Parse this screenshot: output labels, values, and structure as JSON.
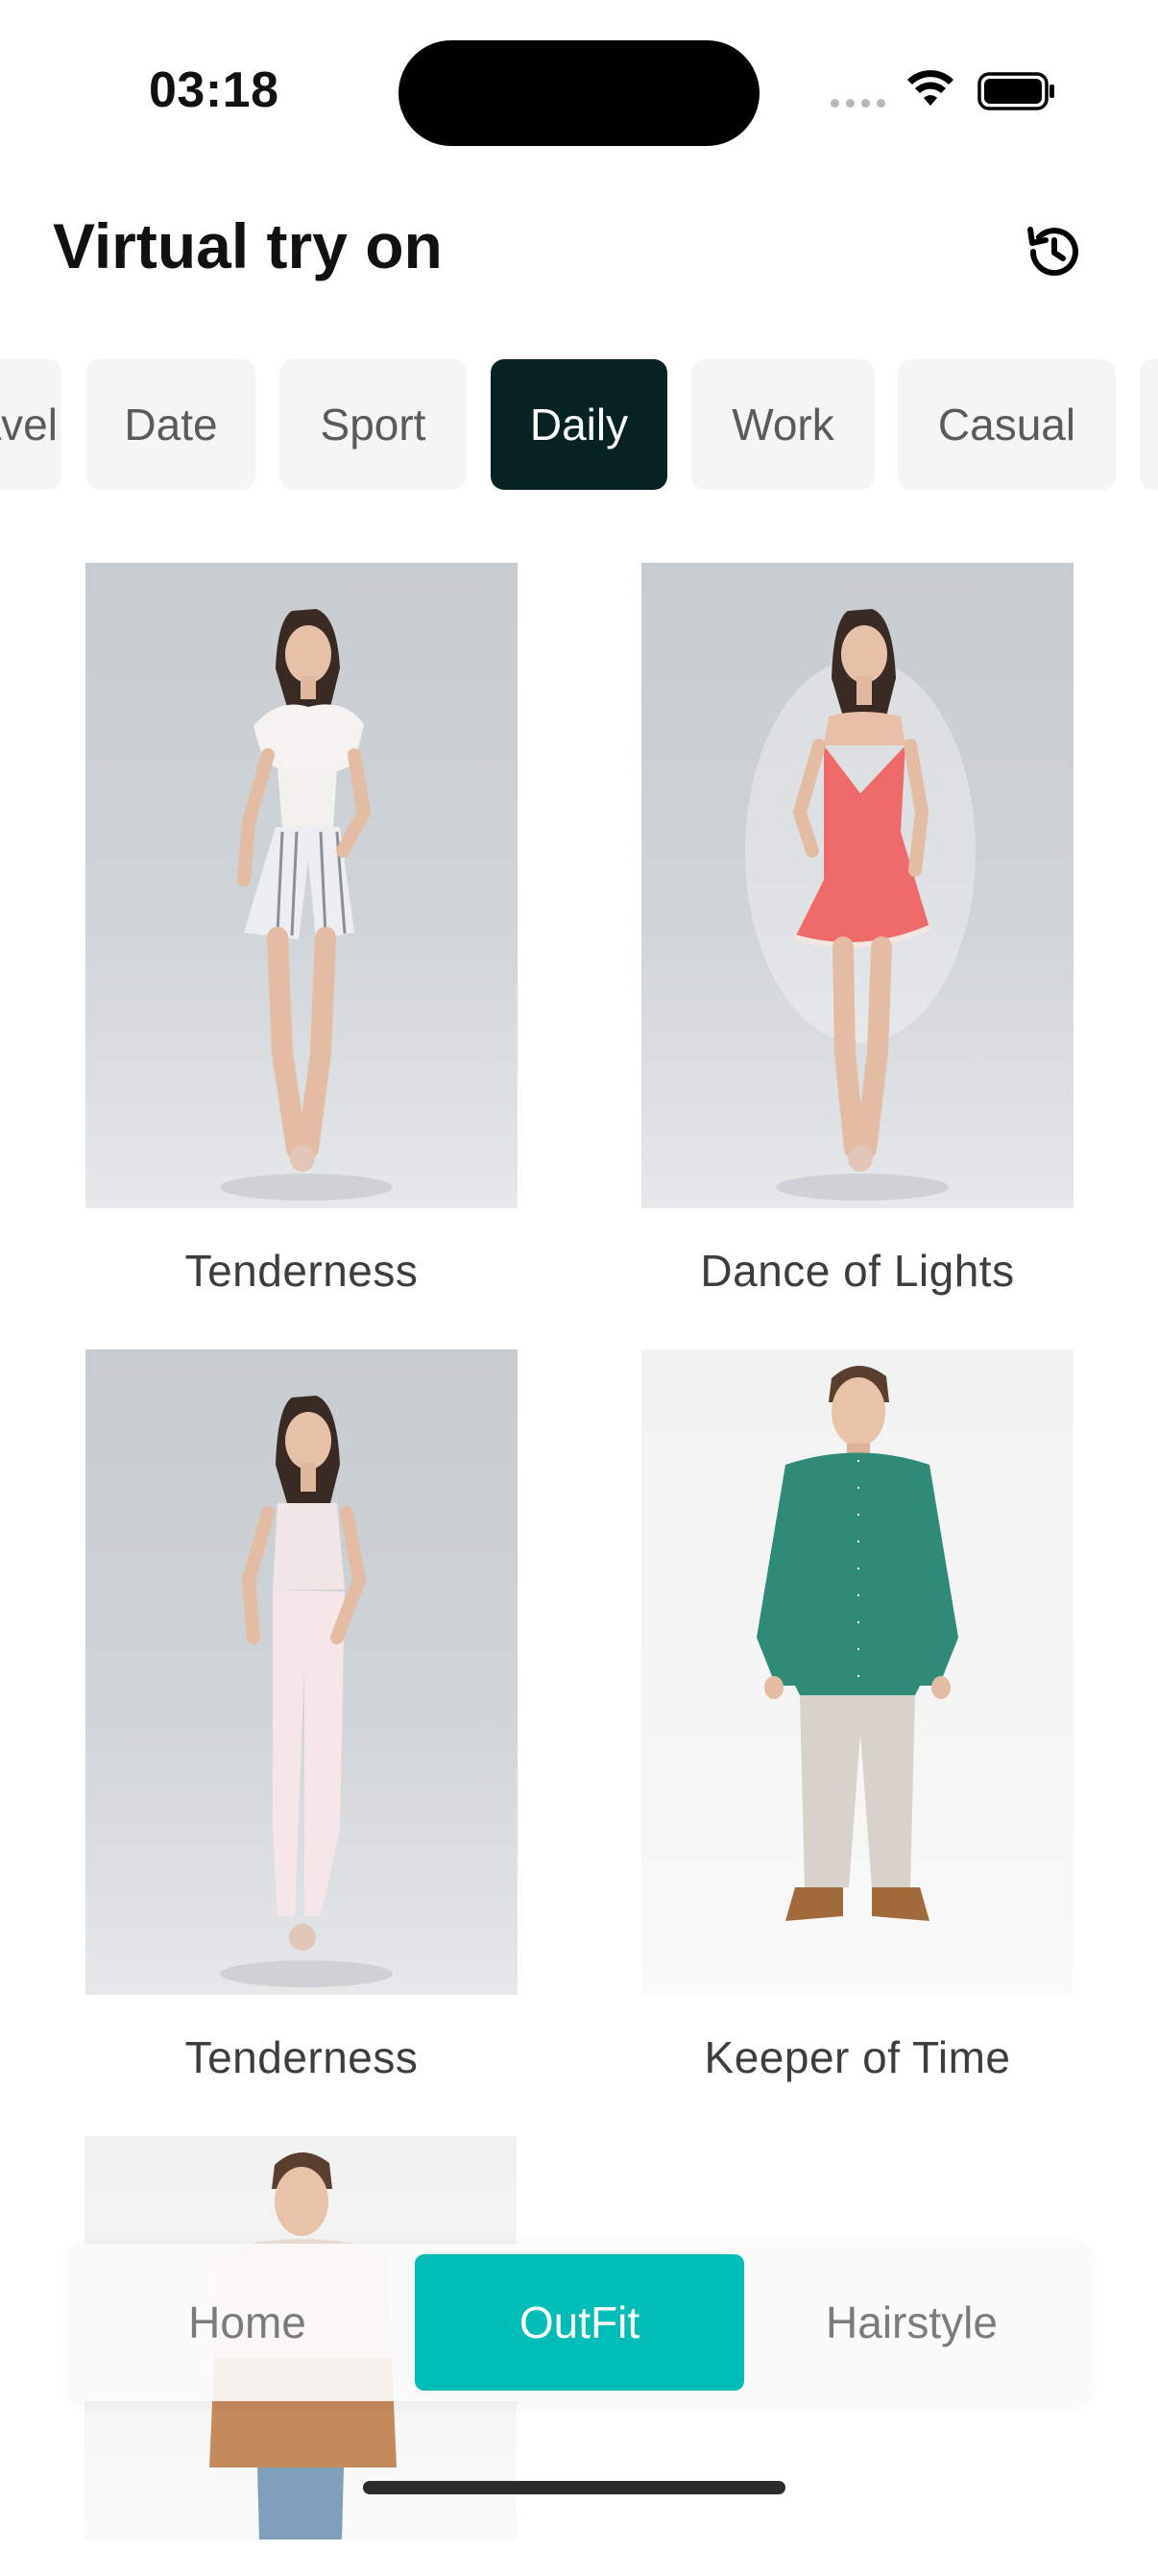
{
  "status": {
    "time": "03:18"
  },
  "header": {
    "title": "Virtual try on"
  },
  "icons": {
    "history": "history-icon",
    "wifi": "wifi-icon",
    "battery": "battery-icon",
    "signal": "signal-icon"
  },
  "tabs": [
    {
      "label": "Travel",
      "active": false
    },
    {
      "label": "Date",
      "active": false
    },
    {
      "label": "Sport",
      "active": false
    },
    {
      "label": "Daily",
      "active": true
    },
    {
      "label": "Work",
      "active": false
    },
    {
      "label": "Casual",
      "active": false
    },
    {
      "label": "",
      "active": false
    }
  ],
  "outfits": [
    {
      "name": "Tenderness"
    },
    {
      "name": "Dance of Lights"
    },
    {
      "name": "Tenderness"
    },
    {
      "name": "Keeper of Time"
    },
    {
      "name": ""
    }
  ],
  "bottom_nav": [
    {
      "label": "Home",
      "active": false
    },
    {
      "label": "OutFit",
      "active": true
    },
    {
      "label": "Hairstyle",
      "active": false
    }
  ],
  "colors": {
    "accent": "#00bdb8",
    "active_tab": "#062222"
  }
}
